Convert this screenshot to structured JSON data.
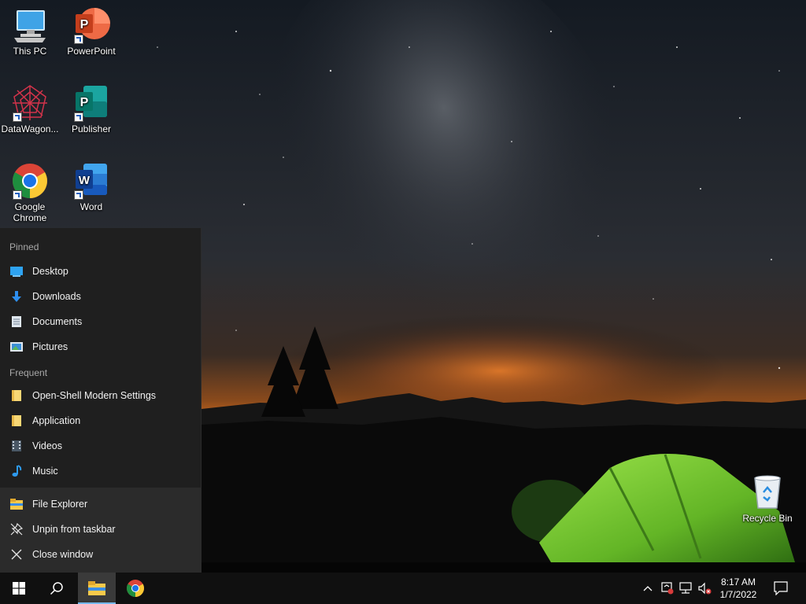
{
  "desktop": {
    "icons": [
      {
        "name": "This PC",
        "icon": "this-pc-icon"
      },
      {
        "name": "PowerPoint",
        "icon": "powerpoint-icon"
      },
      {
        "name": "DataWagon...",
        "icon": "datawagon-icon"
      },
      {
        "name": "Publisher",
        "icon": "publisher-icon"
      },
      {
        "name": "Google Chrome",
        "icon": "chrome-icon"
      },
      {
        "name": "Word",
        "icon": "word-icon"
      },
      {
        "name": "Recycle Bin",
        "icon": "recycle-bin-icon"
      }
    ]
  },
  "jumplist": {
    "pinned_header": "Pinned",
    "pinned": [
      {
        "label": "Desktop",
        "icon": "desktop-icon"
      },
      {
        "label": "Downloads",
        "icon": "download-arrow-icon"
      },
      {
        "label": "Documents",
        "icon": "document-icon"
      },
      {
        "label": "Pictures",
        "icon": "pictures-icon"
      }
    ],
    "frequent_header": "Frequent",
    "frequent": [
      {
        "label": "Open-Shell Modern Settings",
        "icon": "folder-icon"
      },
      {
        "label": "Application",
        "icon": "folder-icon"
      },
      {
        "label": "Videos",
        "icon": "videos-icon"
      },
      {
        "label": "Music",
        "icon": "music-note-icon"
      }
    ],
    "tasks": [
      {
        "label": "File Explorer",
        "icon": "file-explorer-icon"
      },
      {
        "label": "Unpin from taskbar",
        "icon": "unpin-icon"
      },
      {
        "label": "Close window",
        "icon": "close-icon"
      }
    ]
  },
  "taskbar": {
    "start": "windows-logo-icon",
    "search": "search-icon",
    "apps": [
      "file-explorer-icon",
      "chrome-icon"
    ],
    "tray": [
      "chevron-up-icon",
      "network-alert-icon",
      "network-icon",
      "volume-muted-icon"
    ],
    "time": "8:17 AM",
    "date": "1/7/2022",
    "action_center": "notifications-icon"
  },
  "colors": {
    "taskbar_bg": "#101010",
    "jumplist_bg": "#1f1f1f",
    "jumplist_tasks_bg": "#2b2b2b",
    "accent": "#76b9ed"
  }
}
